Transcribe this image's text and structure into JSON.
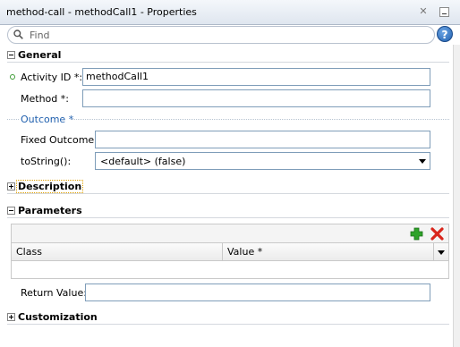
{
  "window": {
    "title": "method-call - methodCall1 - Properties"
  },
  "search": {
    "placeholder": "Find"
  },
  "sections": {
    "general": "General",
    "description": "Description",
    "parameters": "Parameters",
    "customization": "Customization"
  },
  "general": {
    "activity_id_label": "Activity ID *:",
    "activity_id_value": "methodCall1",
    "method_label": "Method *:",
    "method_value": "",
    "outcome_label": "Outcome *",
    "fixed_outcome_label": "Fixed Outcome:",
    "fixed_outcome_value": "",
    "tostring_label": "toString():",
    "tostring_value": "<default> (false)"
  },
  "parameters": {
    "columns": [
      "Class",
      "Value *"
    ],
    "return_value_label": "Return Value:",
    "return_value_value": ""
  },
  "colors": {
    "accent_blue": "#1f5fae",
    "add_green": "#2fa32a",
    "delete_red": "#d9261c"
  }
}
